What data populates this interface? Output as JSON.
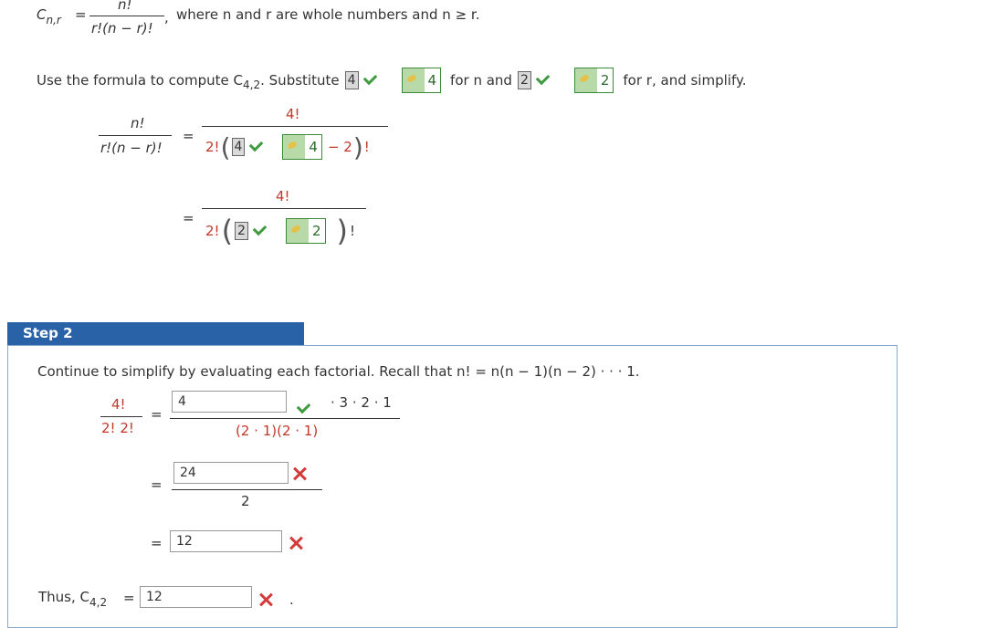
{
  "formula": {
    "lhs": "C",
    "lhs_sub": "n,r",
    "eq": "=",
    "num": "n!",
    "den": "r!(n − r)!",
    "comma": ",",
    "condition": "where n and r are whole numbers and n ≥ r."
  },
  "instruction": {
    "prefix": "Use the formula to compute C",
    "sub": "4,2",
    "mid": ". Substitute",
    "n_value": "4",
    "n_key": "4",
    "for_n": "for n and",
    "r_value": "2",
    "r_key": "2",
    "for_r": "for r, and simplify."
  },
  "step1": {
    "lhs_num": "n!",
    "lhs_den": "r!(n − r)!",
    "eq": "=",
    "row1_num": "4!",
    "row1_den_prefix": "2!",
    "row1_boxval": "4",
    "row1_key": "4",
    "row1_minus": "− 2",
    "row1_suffix": "!",
    "row2_num": "4!",
    "row2_den_prefix": "2!",
    "row2_boxval": "2",
    "row2_key": "2",
    "row2_suffix": "!"
  },
  "step2": {
    "title": "Step 2",
    "recall": "Continue to simplify by evaluating each factorial. Recall that n! = n(n − 1)(n − 2) · · · 1.",
    "lhs_num": "4!",
    "lhs_den": "2! 2!",
    "eq": "=",
    "input1": "4",
    "input1_suffix": "· 3 · 2 · 1",
    "den1": "(2 · 1)(2 · 1)",
    "input2": "24",
    "den2": "2",
    "input3": "12",
    "thus_prefix": "Thus, C",
    "thus_sub": "4,2",
    "thus_eq": "=",
    "input4": "12",
    "period": "."
  },
  "colors": {
    "correct": "#3f9b3f",
    "incorrect": "#d43b3b",
    "step_header": "#2a62a8",
    "key_green": "#b8d9a8"
  }
}
